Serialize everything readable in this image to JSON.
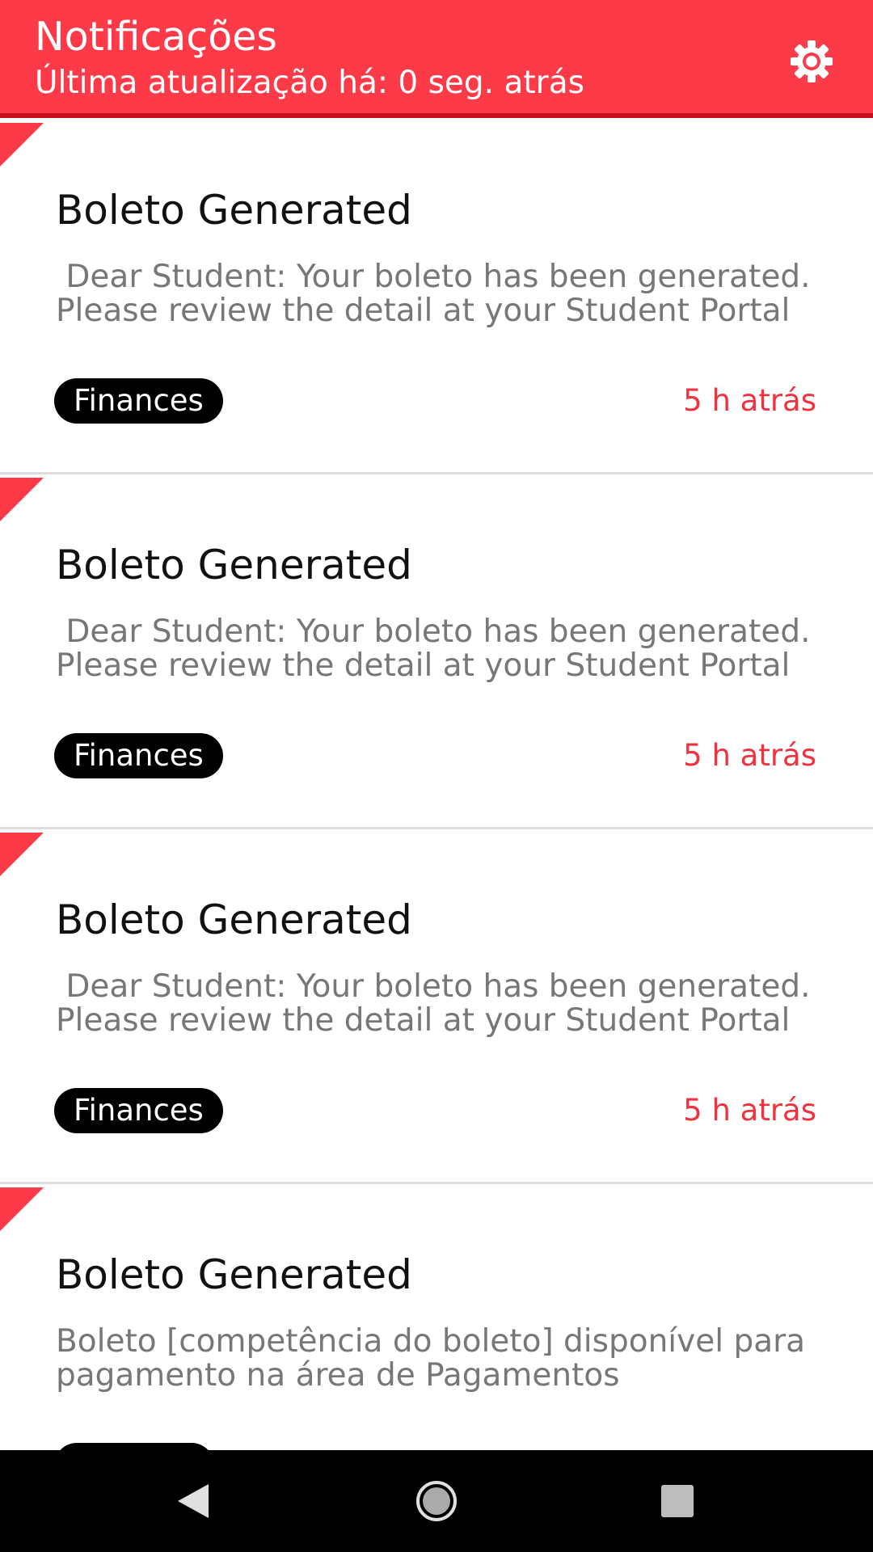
{
  "header": {
    "title": "Notificações",
    "subtitle": "Última atualização há: 0 seg. atrás",
    "settings_icon": "gear-icon",
    "background_color": "#fd3b48"
  },
  "notifications": [
    {
      "title": "Boleto Generated",
      "message": " Dear Student: Your boleto has been generated.\nPlease review the detail at your Student Portal",
      "category": "Finances",
      "time": "5 h atrás"
    },
    {
      "title": "Boleto Generated",
      "message": " Dear Student: Your boleto has been generated.\nPlease review the detail at your Student Portal",
      "category": "Finances",
      "time": "5 h atrás"
    },
    {
      "title": "Boleto Generated",
      "message": " Dear Student: Your boleto has been generated.\nPlease review the detail at your Student Portal",
      "category": "Finances",
      "time": "5 h atrás"
    },
    {
      "title": "Boleto Generated",
      "message": "Boleto [competência do boleto] disponível para\npagamento na área de Pagamentos",
      "category": "",
      "time": ""
    }
  ],
  "nav": {
    "back_icon": "back-triangle-icon",
    "home_icon": "home-circle-icon",
    "recents_icon": "recents-square-icon"
  },
  "colors": {
    "accent": "#fd3b48",
    "time_text": "#f0323f",
    "badge_bg": "#000000"
  }
}
